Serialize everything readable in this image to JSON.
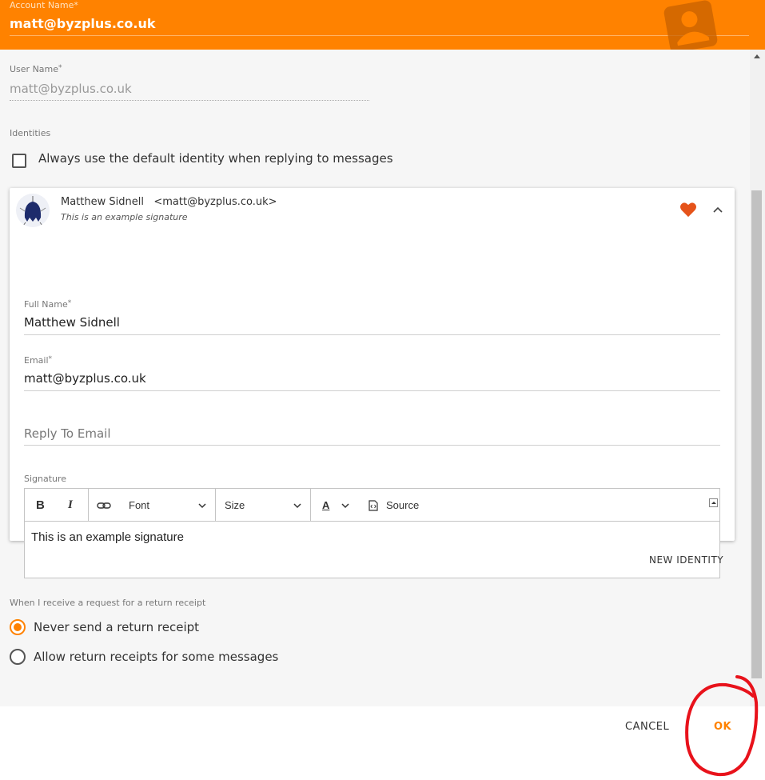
{
  "header": {
    "account_name_label": "Account Name",
    "account_name_value": "matt@byzplus.co.uk",
    "required_mark": "*"
  },
  "user_name": {
    "label": "User Name",
    "value": "matt@byzplus.co.uk"
  },
  "identities": {
    "label": "Identities",
    "default_checkbox_label": "Always use the default identity when replying to messages",
    "default_checkbox_checked": false
  },
  "identity": {
    "name": "Matthew Sidnell",
    "email_display": "<matt@byzplus.co.uk>",
    "signature_preview": "This is an example signature",
    "full_name_label": "Full Name",
    "full_name_value": "Matthew Sidnell",
    "email_label": "Email",
    "email_value": "matt@byzplus.co.uk",
    "reply_to_placeholder": "Reply To Email",
    "signature_label": "Signature",
    "signature_text": "This is an example signature"
  },
  "editor_toolbar": {
    "bold": "B",
    "italic": "I",
    "font": "Font",
    "size": "Size",
    "text_color": "A",
    "source": "Source"
  },
  "new_identity_label": "NEW IDENTITY",
  "return_receipt": {
    "label": "When I receive a request for a return receipt",
    "options": [
      {
        "label": "Never send a return receipt",
        "selected": true
      },
      {
        "label": "Allow return receipts for some messages",
        "selected": false
      }
    ]
  },
  "footer": {
    "cancel": "CANCEL",
    "ok": "OK"
  },
  "colors": {
    "accent": "#ff8200",
    "heart": "#e5531a",
    "annotation": "#e8121b"
  },
  "icons": [
    "account-icon",
    "heart-icon",
    "chevron-up-icon",
    "link-icon",
    "chevron-down-icon",
    "source-icon",
    "expand-icon"
  ]
}
